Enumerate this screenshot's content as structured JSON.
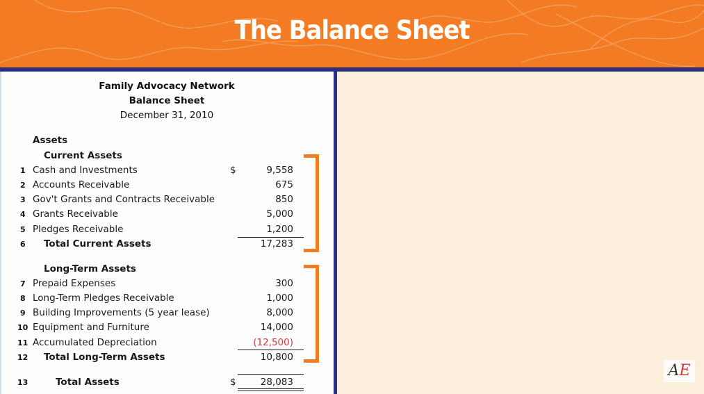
{
  "header": {
    "title": "The Balance Sheet"
  },
  "statement": {
    "organization": "Family Advocacy Network",
    "report_name": "Balance Sheet",
    "date": "December 31, 2010",
    "section": "Assets",
    "currency_symbol": "$",
    "current_assets": {
      "heading": "Current Assets",
      "rows": [
        {
          "num": "1",
          "label": "Cash and Investments",
          "value": "9,558"
        },
        {
          "num": "2",
          "label": "Accounts Receivable",
          "value": "675"
        },
        {
          "num": "3",
          "label": "Gov't Grants and Contracts Receivable",
          "value": "850"
        },
        {
          "num": "4",
          "label": "Grants Receivable",
          "value": "5,000"
        },
        {
          "num": "5",
          "label": "Pledges Receivable",
          "value": "1,200"
        }
      ],
      "total": {
        "num": "6",
        "label": "Total Current Assets",
        "value": "17,283"
      }
    },
    "long_term_assets": {
      "heading": "Long-Term Assets",
      "rows": [
        {
          "num": "7",
          "label": "Prepaid Expenses",
          "value": "300"
        },
        {
          "num": "8",
          "label": "Long-Term Pledges Receivable",
          "value": "1,000"
        },
        {
          "num": "9",
          "label": "Building Improvements (5 year lease)",
          "value": "8,000"
        },
        {
          "num": "10",
          "label": "Equipment and Furniture",
          "value": "14,000"
        },
        {
          "num": "11",
          "label": "Accumulated Depreciation",
          "value": "(12,500)"
        }
      ],
      "total": {
        "num": "12",
        "label": "Total Long-Term Assets",
        "value": "10,800"
      }
    },
    "total_assets": {
      "num": "13",
      "label": "Total Assets",
      "value": "28,083"
    }
  },
  "logo": {
    "letter1": "A",
    "letter2": "E"
  },
  "colors": {
    "banner": "#f27b23",
    "navy": "#2a2f7e",
    "bracket": "#f07f23",
    "negative": "#d8343b",
    "right_bg": "#fbefdc"
  }
}
